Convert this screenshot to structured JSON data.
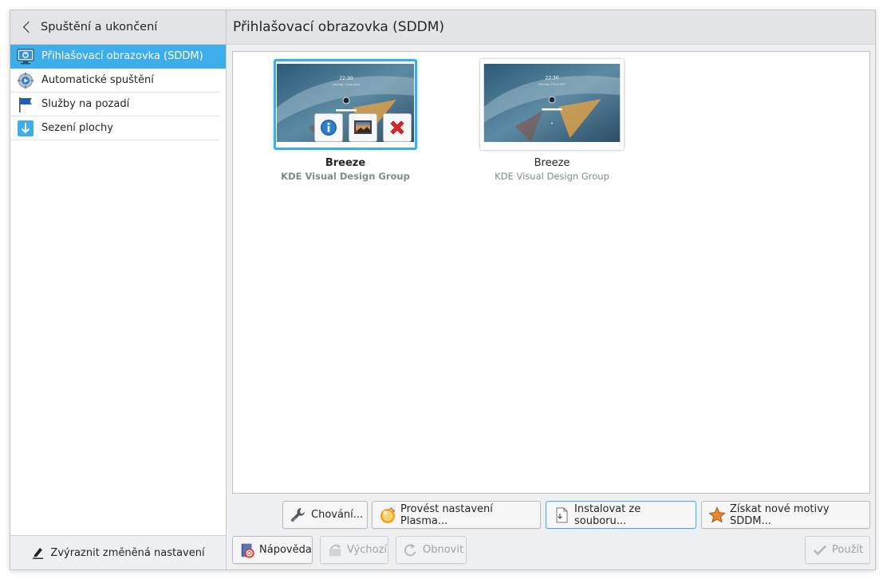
{
  "sidebar": {
    "back_title": "Spuštění a ukončení",
    "items": [
      {
        "label": "Přihlašovací obrazovka (SDDM)",
        "icon": "monitor-login-icon",
        "active": true
      },
      {
        "label": "Automatické spuštění",
        "icon": "gear-icon"
      },
      {
        "label": "Služby na pozadí",
        "icon": "flag-icon"
      },
      {
        "label": "Sezení plochy",
        "icon": "download-arrow-icon"
      }
    ],
    "footer_label": "Zvýraznit změněná nastavení"
  },
  "main": {
    "title": "Přihlašovací obrazovka (SDDM)",
    "themes": [
      {
        "name": "Breeze",
        "author": "KDE Visual Design Group",
        "selected": true,
        "preview_time": "22:30",
        "preview_date": "Saturday, 27 July 2019"
      },
      {
        "name": "Breeze",
        "author": "KDE Visual Design Group",
        "selected": false,
        "preview_time": "22:30",
        "preview_date": "Saturday, 27 July 2019"
      }
    ],
    "overlay_actions": [
      "info-icon",
      "preview-image-icon",
      "delete-icon"
    ],
    "actions": {
      "behavior": "Chování...",
      "apply_plasma": "Provést nastavení Plasma...",
      "install_file": "Instalovat ze souboru...",
      "get_new": "Získat nové motivy SDDM..."
    }
  },
  "footer": {
    "help": "Nápověda",
    "defaults": "Výchozí",
    "reset": "Obnovit",
    "apply": "Použít"
  },
  "colors": {
    "accent": "#3daee9",
    "window_bg": "#eff0f1",
    "header_bg": "#e3e4e6"
  }
}
